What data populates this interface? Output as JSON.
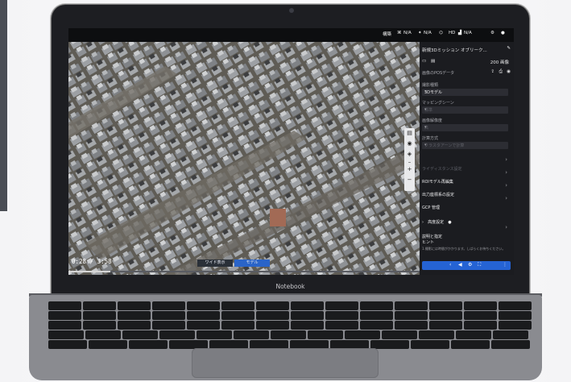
{
  "device": {
    "brand_label": "Notebook"
  },
  "topbar": {
    "items": [
      "構築",
      "N/A",
      "N/A",
      "HD",
      "N/A"
    ]
  },
  "video": {
    "time": "0:28 / 3:58",
    "progress": 0.12,
    "btn_left": "ワイド表示",
    "btn_right": "モデル"
  },
  "panel": {
    "title": "新規3Dミッション  オブリーク...",
    "photo_count": "200 画像",
    "section_label": "画像のPOSデータ",
    "field1_label": "撮影種類",
    "field1_value": "3Dモデル",
    "field2_label": "マッピングシーン",
    "field2_value": "標準",
    "field3_label": "画像解像度",
    "field3_value": "高",
    "field4_label": "計算方式",
    "field4_value": "クラスタアーンで計算",
    "menu1": "ライディスタンス設定",
    "menu2": "ROIモデル再編集",
    "menu3": "出力座標系の設定",
    "menu4": "GCP 管理",
    "menu5": "高度設定",
    "menu6": "説明と指定",
    "hint_title": "ヒント",
    "hint_text": "1.撮影には時間がかかります。しばらくお待ちください。"
  },
  "colors": {
    "accent": "#2563d4",
    "panel_bg": "#1b1c20"
  }
}
